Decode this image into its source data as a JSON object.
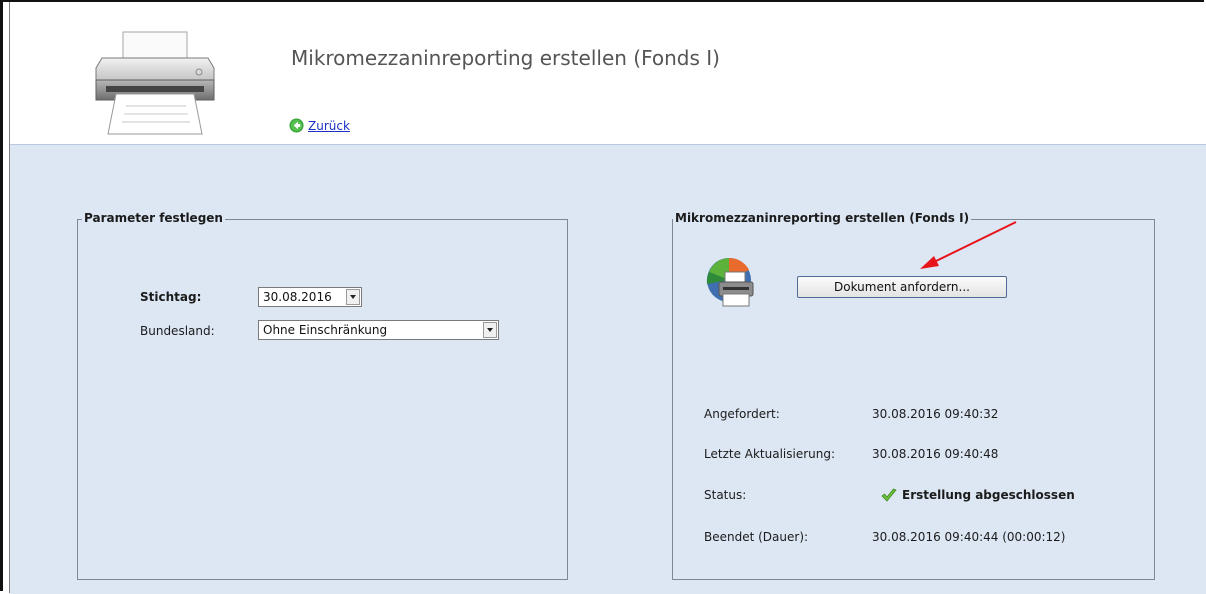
{
  "header": {
    "title": "Mikromezzaninreporting erstellen (Fonds I)",
    "back_label": "Zurück"
  },
  "parameters": {
    "legend": "Parameter festlegen",
    "stichtag_label": "Stichtag:",
    "stichtag_value": "30.08.2016",
    "bundesland_label": "Bundesland:",
    "bundesland_value": "Ohne Einschränkung"
  },
  "report": {
    "legend": "Mikromezzaninreporting erstellen (Fonds I)",
    "request_button": "Dokument anfordern...",
    "rows": [
      {
        "label": "Angefordert:",
        "value": "30.08.2016 09:40:32"
      },
      {
        "label": "Letzte Aktualisierung:",
        "value": "30.08.2016 09:40:48"
      },
      {
        "label": "Status:",
        "value": "Erstellung abgeschlossen"
      },
      {
        "label": "Beendet (Dauer):",
        "value": "30.08.2016 09:40:44 (00:00:12)"
      }
    ]
  },
  "icons": {
    "printer": "printer-icon",
    "back": "back-arrow-icon",
    "document_print": "document-print-icon",
    "status": "checkmark-icon"
  },
  "colors": {
    "content_background": "#dde7f4",
    "link": "#1a30c7",
    "annotation_arrow": "#e8141b",
    "status_check": "#5fae2e"
  }
}
